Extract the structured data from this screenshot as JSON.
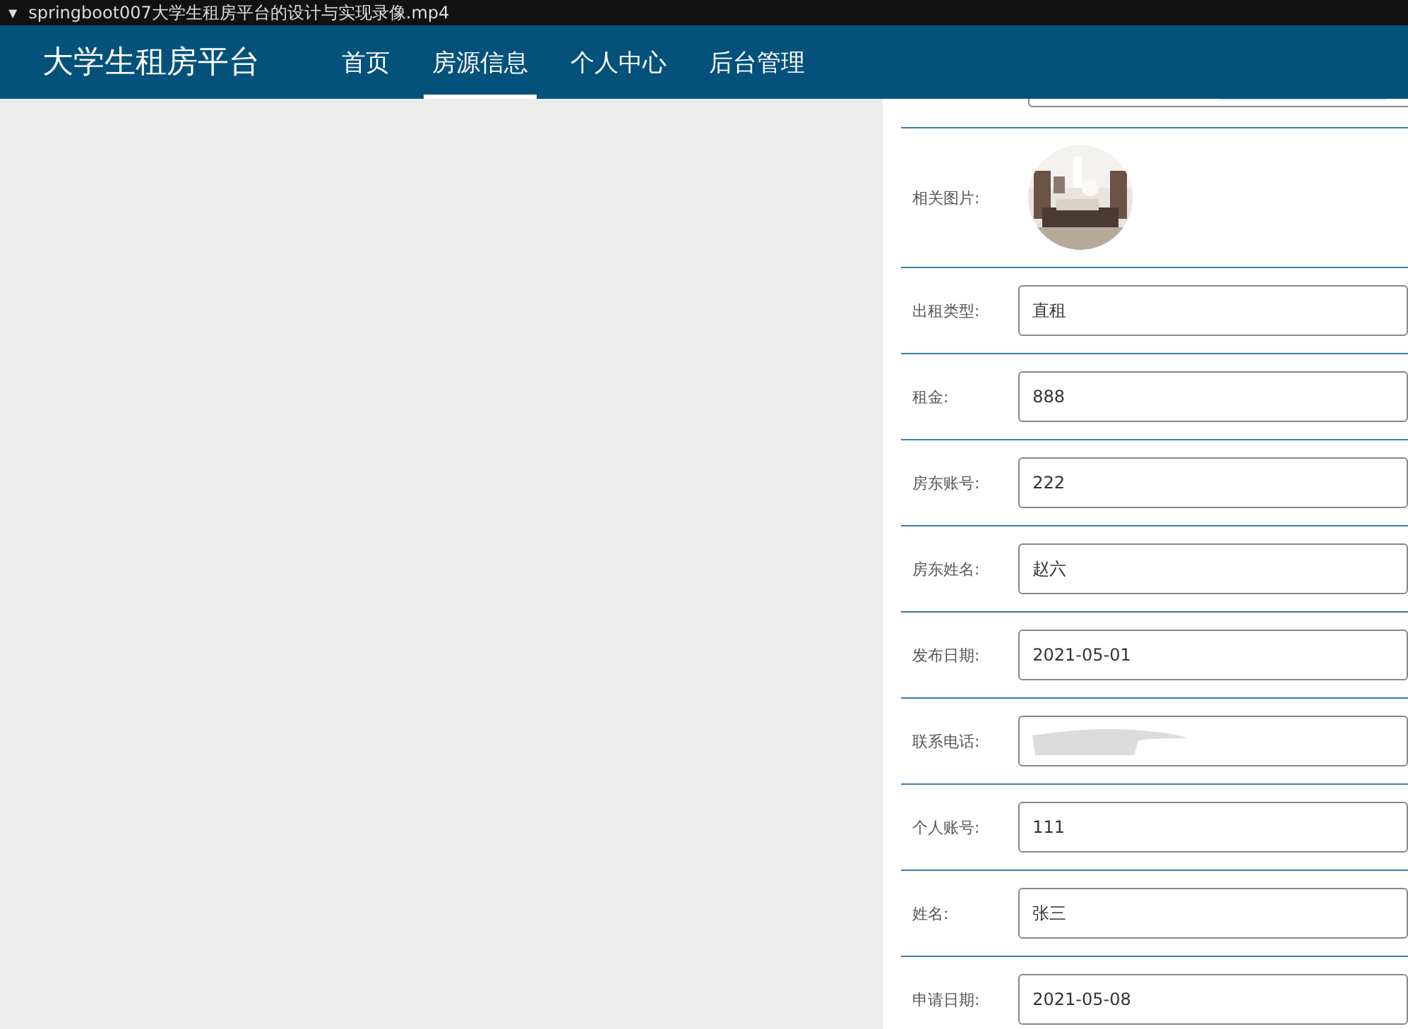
{
  "video_bar": {
    "icon": "▼",
    "title": "springboot007大学生租房平台的设计与实现录像.mp4"
  },
  "navbar": {
    "logo": "大学生租房平台",
    "items": [
      {
        "label": "首页",
        "selected": false
      },
      {
        "label": "房源信息",
        "selected": true
      },
      {
        "label": "个人中心",
        "selected": false
      },
      {
        "label": "后台管理",
        "selected": false
      }
    ]
  },
  "form": {
    "rows": [
      {
        "kind": "picture",
        "label": "相关图片:"
      },
      {
        "kind": "text",
        "label": "出租类型:",
        "value": "直租"
      },
      {
        "kind": "text",
        "label": "租金:",
        "value": "888"
      },
      {
        "kind": "text",
        "label": "房东账号:",
        "value": "222"
      },
      {
        "kind": "text",
        "label": "房东姓名:",
        "value": "赵六"
      },
      {
        "kind": "text",
        "label": "发布日期:",
        "value": "2021-05-01"
      },
      {
        "kind": "redacted",
        "label": "联系电话:"
      },
      {
        "kind": "text",
        "label": "个人账号:",
        "value": "111"
      },
      {
        "kind": "text",
        "label": "姓名:",
        "value": "张三"
      },
      {
        "kind": "text",
        "label": "申请日期:",
        "value": "2021-05-08"
      }
    ]
  }
}
